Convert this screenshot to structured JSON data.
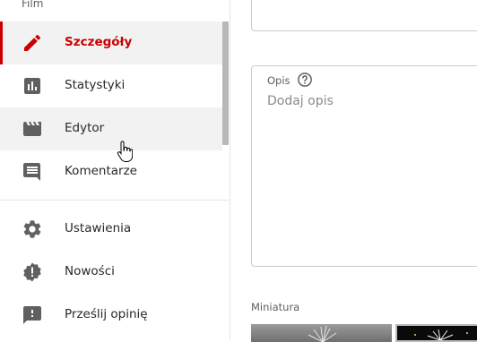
{
  "sidebar": {
    "section_label": "Film",
    "items": [
      {
        "label": "Szczegóły",
        "icon": "pencil-icon",
        "active": true
      },
      {
        "label": "Statystyki",
        "icon": "analytics-icon"
      },
      {
        "label": "Edytor",
        "icon": "clapperboard-icon"
      },
      {
        "label": "Komentarze",
        "icon": "comment-icon"
      },
      {
        "label": "Ustawienia",
        "icon": "gear-icon"
      },
      {
        "label": "Nowości",
        "icon": "alert-badge-icon"
      },
      {
        "label": "Prześlij opinię",
        "icon": "feedback-icon"
      }
    ]
  },
  "main": {
    "description": {
      "label": "Opis",
      "placeholder": "Dodaj opis"
    },
    "thumbnail": {
      "label": "Miniatura"
    }
  },
  "colors": {
    "accent": "#cc0000",
    "text": "#282828",
    "muted": "#606060",
    "hover": "#f2f2f2",
    "icon": "#606060"
  }
}
